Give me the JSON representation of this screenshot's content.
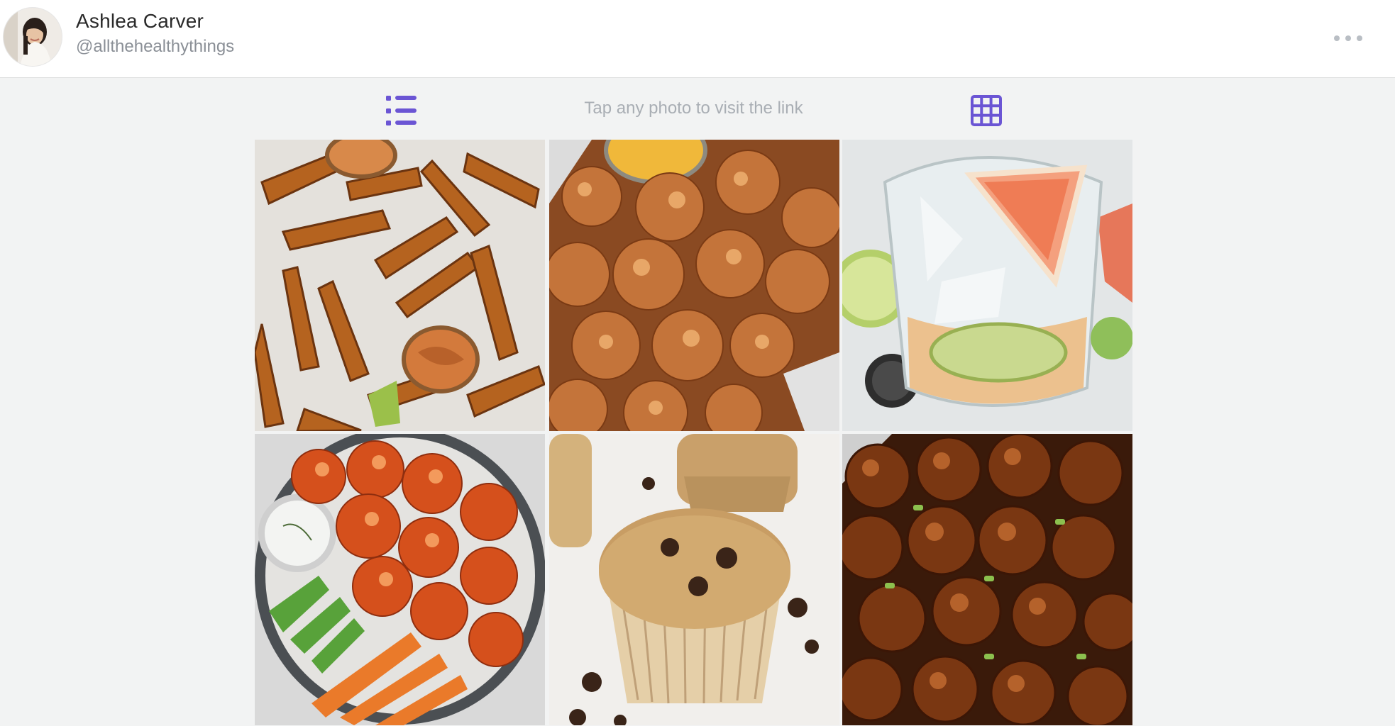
{
  "profile": {
    "name": "Ashlea Carver",
    "handle": "@allthehealthythings"
  },
  "toolbar": {
    "hint": "Tap any photo to visit the link",
    "list_icon": "list-view-icon",
    "grid_icon": "grid-view-icon",
    "more_icon": "more-options-icon"
  },
  "colors": {
    "accent": "#6b55d4",
    "header_bg": "#ffffff",
    "page_bg": "#f2f3f3"
  },
  "photos": [
    {
      "subject": "potato-wedges"
    },
    {
      "subject": "crispy-cauliflower-bites"
    },
    {
      "subject": "grapefruit-cocktail"
    },
    {
      "subject": "buffalo-cauliflower"
    },
    {
      "subject": "chocolate-chip-muffins"
    },
    {
      "subject": "glazed-meatballs"
    }
  ]
}
